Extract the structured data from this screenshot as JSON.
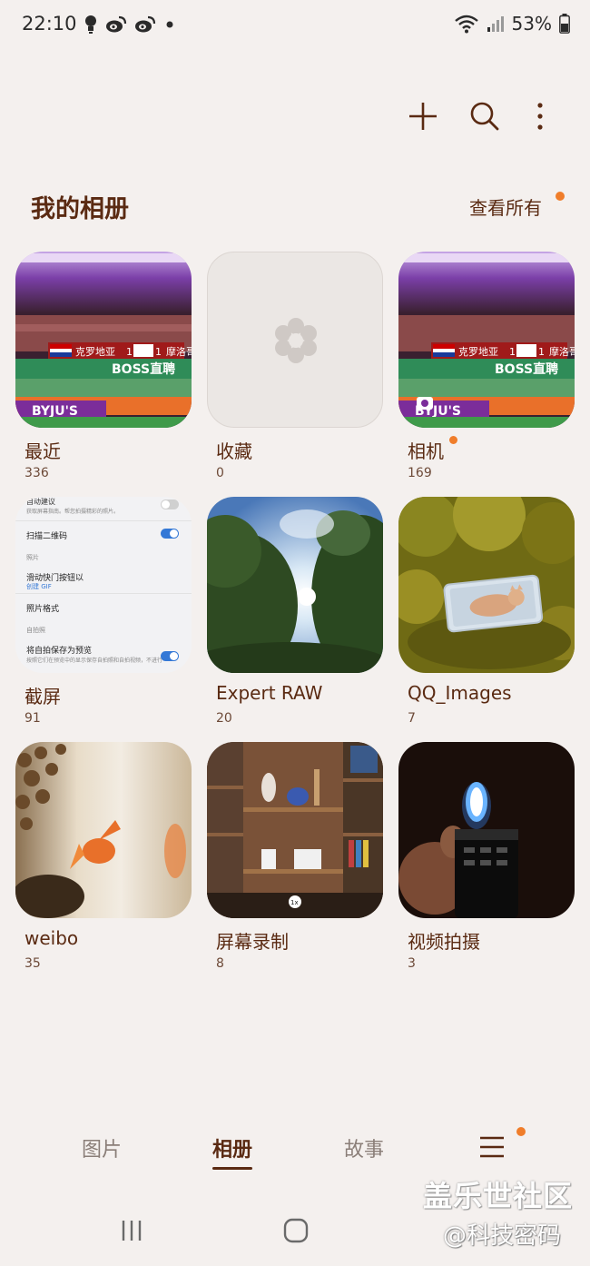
{
  "status_bar": {
    "time": "22:10",
    "battery": "53%"
  },
  "toolbar": {
    "add_icon": "plus-icon",
    "search_icon": "search-icon",
    "more_icon": "more-vertical-icon"
  },
  "header": {
    "title": "我的相册",
    "view_all": "查看所有"
  },
  "albums": [
    {
      "name": "最近",
      "count": "336"
    },
    {
      "name": "收藏",
      "count": "0"
    },
    {
      "name": "相机",
      "count": "169"
    },
    {
      "name": "截屏",
      "count": "91"
    },
    {
      "name": "Expert RAW",
      "count": "20"
    },
    {
      "name": "QQ_Images",
      "count": "7"
    },
    {
      "name": "weibo",
      "count": "35"
    },
    {
      "name": "屏幕录制",
      "count": "8"
    },
    {
      "name": "视频拍摄",
      "count": "3"
    }
  ],
  "thumb_text": {
    "team1": "克罗地亚",
    "score1": "1",
    "score2": "1",
    "team2": "摩洛哥",
    "ad1": "BOSS直聘",
    "ad2": "BYJU'S",
    "settings": [
      {
        "label": "自动建议",
        "sub": "获取屏幕指南。帮您拍摄精彩的照片。"
      },
      {
        "label": "扫描二维码",
        "sub": ""
      },
      {
        "label": "照片",
        "sub": ""
      },
      {
        "label": "滑动快门按钮以",
        "sub": "创建 GIF"
      },
      {
        "label": "照片格式",
        "sub": ""
      },
      {
        "label": "自拍照",
        "sub": ""
      },
      {
        "label": "将自拍保存为预览",
        "sub": "按照它们在预览中的显示保存自拍照和自拍视频，不进行翻"
      }
    ],
    "zoom": "1x"
  },
  "bottom_nav": {
    "pictures": "图片",
    "albums": "相册",
    "stories": "故事",
    "menu_icon": "hamburger-menu-icon"
  },
  "watermark": {
    "line1": "盖乐世社区",
    "line2": "@科技密码"
  },
  "colors": {
    "background": "#f4f0ee",
    "text_brown": "#5a2a12",
    "accent_dot": "#f07d2a"
  }
}
